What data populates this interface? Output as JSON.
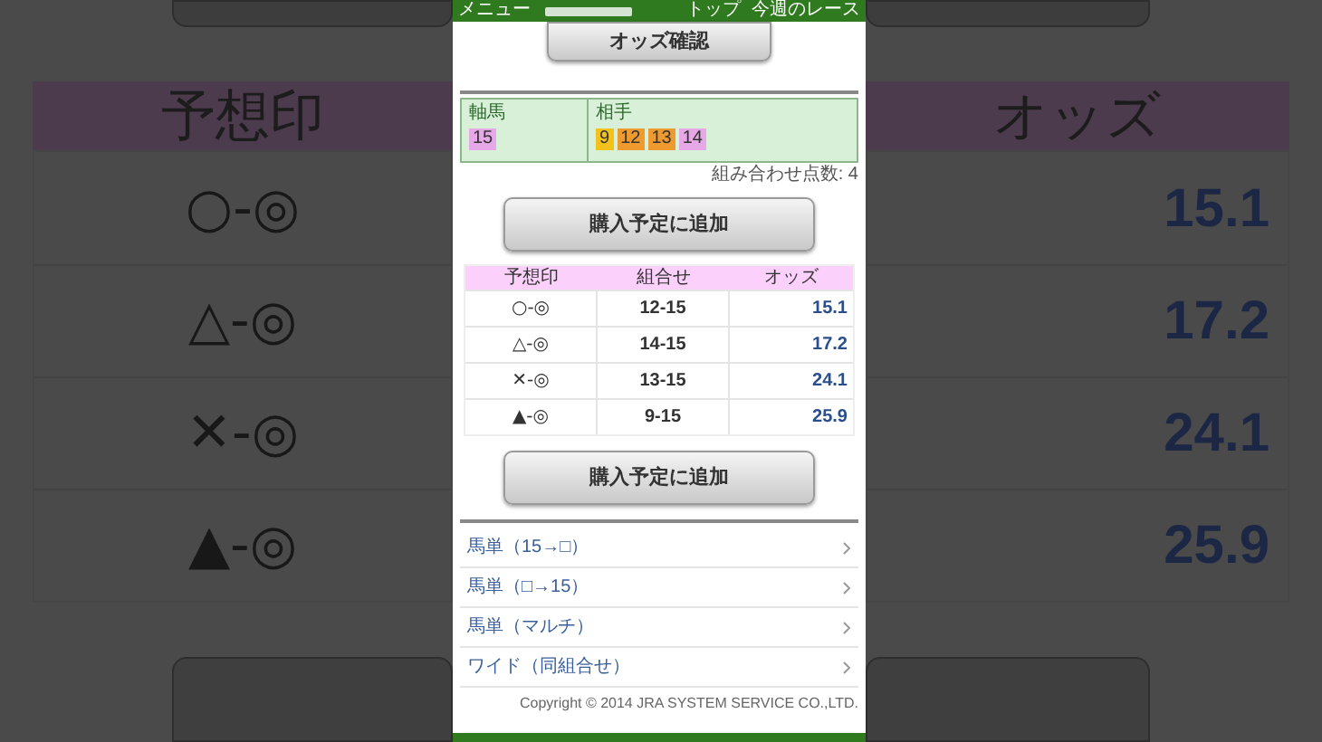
{
  "backdrop": {
    "left_header": "予想印",
    "left_rows": [
      "○-◎",
      "△-◎",
      "✕-◎",
      "▲-◎"
    ],
    "right_header": "オッズ",
    "right_rows": [
      "15.1",
      "17.2",
      "24.1",
      "25.9"
    ]
  },
  "header": {
    "menu": "メニュー",
    "links": [
      "トップ",
      "今週のレース"
    ]
  },
  "odds_button": "オッズ確認",
  "selection": {
    "axis_label": "軸馬",
    "axis": [
      {
        "number": "15",
        "color": "#e6a8e6"
      }
    ],
    "partner_label": "相手",
    "partners": [
      {
        "number": "9",
        "color": "#f2c21a"
      },
      {
        "number": "12",
        "color": "#ee9a2e"
      },
      {
        "number": "13",
        "color": "#ee9a2e"
      },
      {
        "number": "14",
        "color": "#e6a8e6"
      }
    ]
  },
  "count": "組み合わせ点数: 4",
  "add_buttons": [
    "購入予定に追加",
    "購入予定に追加"
  ],
  "table": {
    "columns": [
      "予想印",
      "組合せ",
      "オッズ"
    ],
    "rows": [
      {
        "mark": "○-◎",
        "combo": "12-15",
        "odds": "15.1"
      },
      {
        "mark": "△-◎",
        "combo": "14-15",
        "odds": "17.2"
      },
      {
        "mark": "✕-◎",
        "combo": "13-15",
        "odds": "24.1"
      },
      {
        "mark": "▲-◎",
        "combo": "9-15",
        "odds": "25.9"
      }
    ]
  },
  "links": [
    "馬単（15→□）",
    "馬単（□→15）",
    "馬単（マルチ）",
    "ワイド（同組合せ）"
  ],
  "copyright": "Copyright © 2014 JRA SYSTEM SERVICE CO.,LTD."
}
